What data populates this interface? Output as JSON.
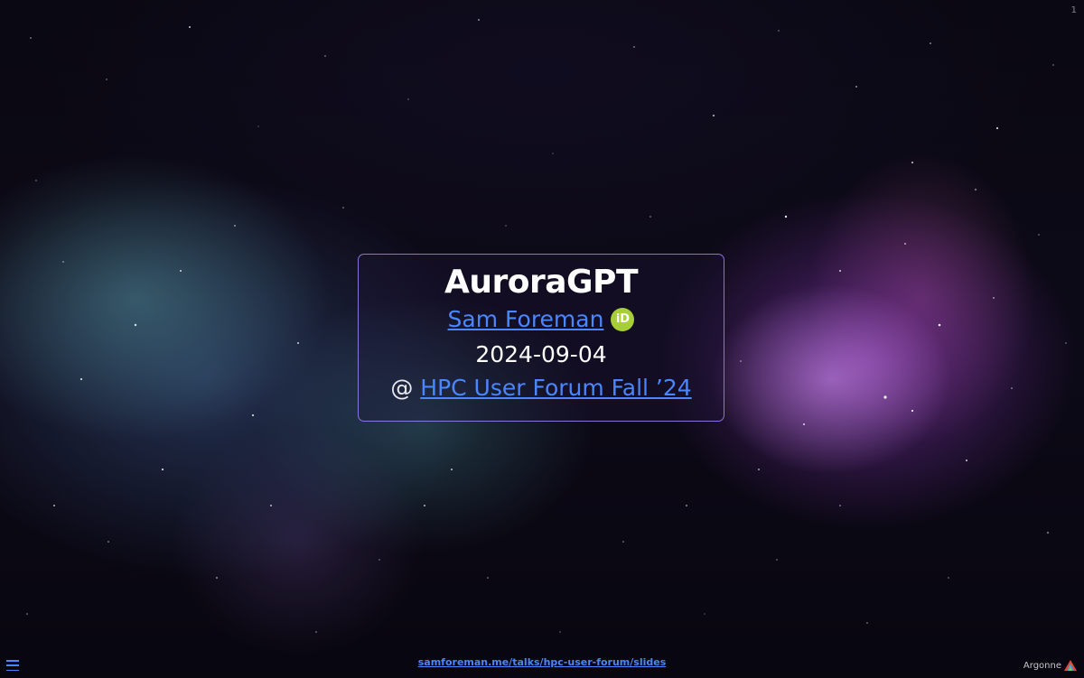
{
  "slide": {
    "title": "AuroraGPT",
    "author": "Sam Foreman",
    "date": "2024-09-04",
    "venue_prefix": "@",
    "venue": "HPC User Forum Fall ’24",
    "slide_number": "1"
  },
  "footer": {
    "url_text": "samforeman.me/talks/hpc-user-forum/slides"
  },
  "logo": {
    "text": "Argonne"
  },
  "icons": {
    "author_badge": "orcid-icon",
    "menu": "hamburger-menu-icon",
    "logo": "argonne-logo"
  },
  "colors": {
    "link": "#4a86ff",
    "card_border": "#a082ff",
    "orcid": "#a6ce39"
  }
}
